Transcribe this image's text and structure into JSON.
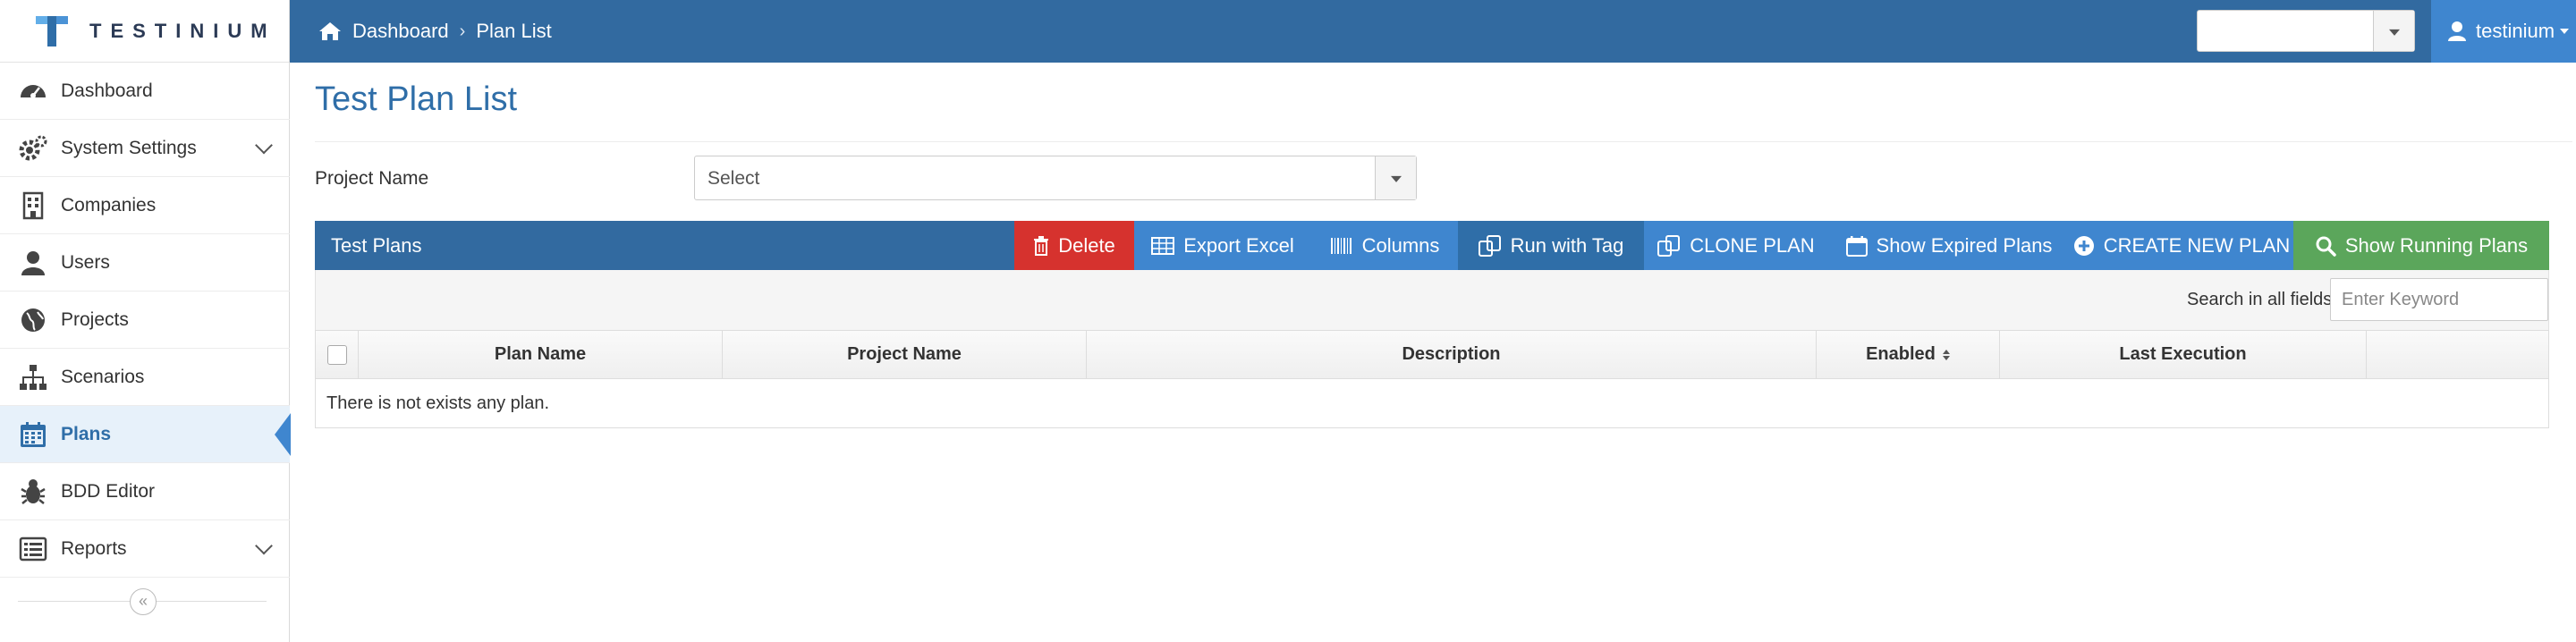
{
  "app": {
    "logo_text": "TESTINIUM"
  },
  "breadcrumb": {
    "items": [
      "Dashboard",
      "Plan List"
    ]
  },
  "header": {
    "user_name": "testinium",
    "top_select_value": ""
  },
  "sidebar": {
    "items": [
      {
        "label": "Dashboard",
        "icon": "dashboard-icon"
      },
      {
        "label": "System Settings",
        "icon": "gears-icon"
      },
      {
        "label": "Companies",
        "icon": "building-icon"
      },
      {
        "label": "Users",
        "icon": "user-icon"
      },
      {
        "label": "Projects",
        "icon": "globe-icon"
      },
      {
        "label": "Scenarios",
        "icon": "sitemap-icon"
      },
      {
        "label": "Plans",
        "icon": "calendar-icon"
      },
      {
        "label": "BDD Editor",
        "icon": "bug-icon"
      },
      {
        "label": "Reports",
        "icon": "list-icon"
      }
    ],
    "active": "Plans",
    "collapse_label": "«"
  },
  "main": {
    "title": "Test Plan List",
    "project_filter": {
      "label": "Project Name",
      "value": "Select"
    },
    "panel": {
      "title": "Test Plans",
      "buttons": {
        "delete": "Delete",
        "export": "Export Excel",
        "columns": "Columns",
        "run_with_tag": "Run with Tag",
        "clone": "CLONE PLAN",
        "expired": "Show Expired Plans",
        "create": "CREATE NEW PLAN",
        "running": "Show Running Plans"
      }
    },
    "search": {
      "label": "Search in all fields:",
      "placeholder": "Enter Keyword",
      "value": ""
    },
    "table": {
      "columns": [
        "Plan Name",
        "Project Name",
        "Description",
        "Enabled",
        "Last Execution",
        ""
      ],
      "empty_message": "There is not exists any plan."
    }
  },
  "colors": {
    "header": "#326aa0",
    "accent": "#3f86cf",
    "danger": "#d6322e",
    "success": "#5ba65b"
  }
}
